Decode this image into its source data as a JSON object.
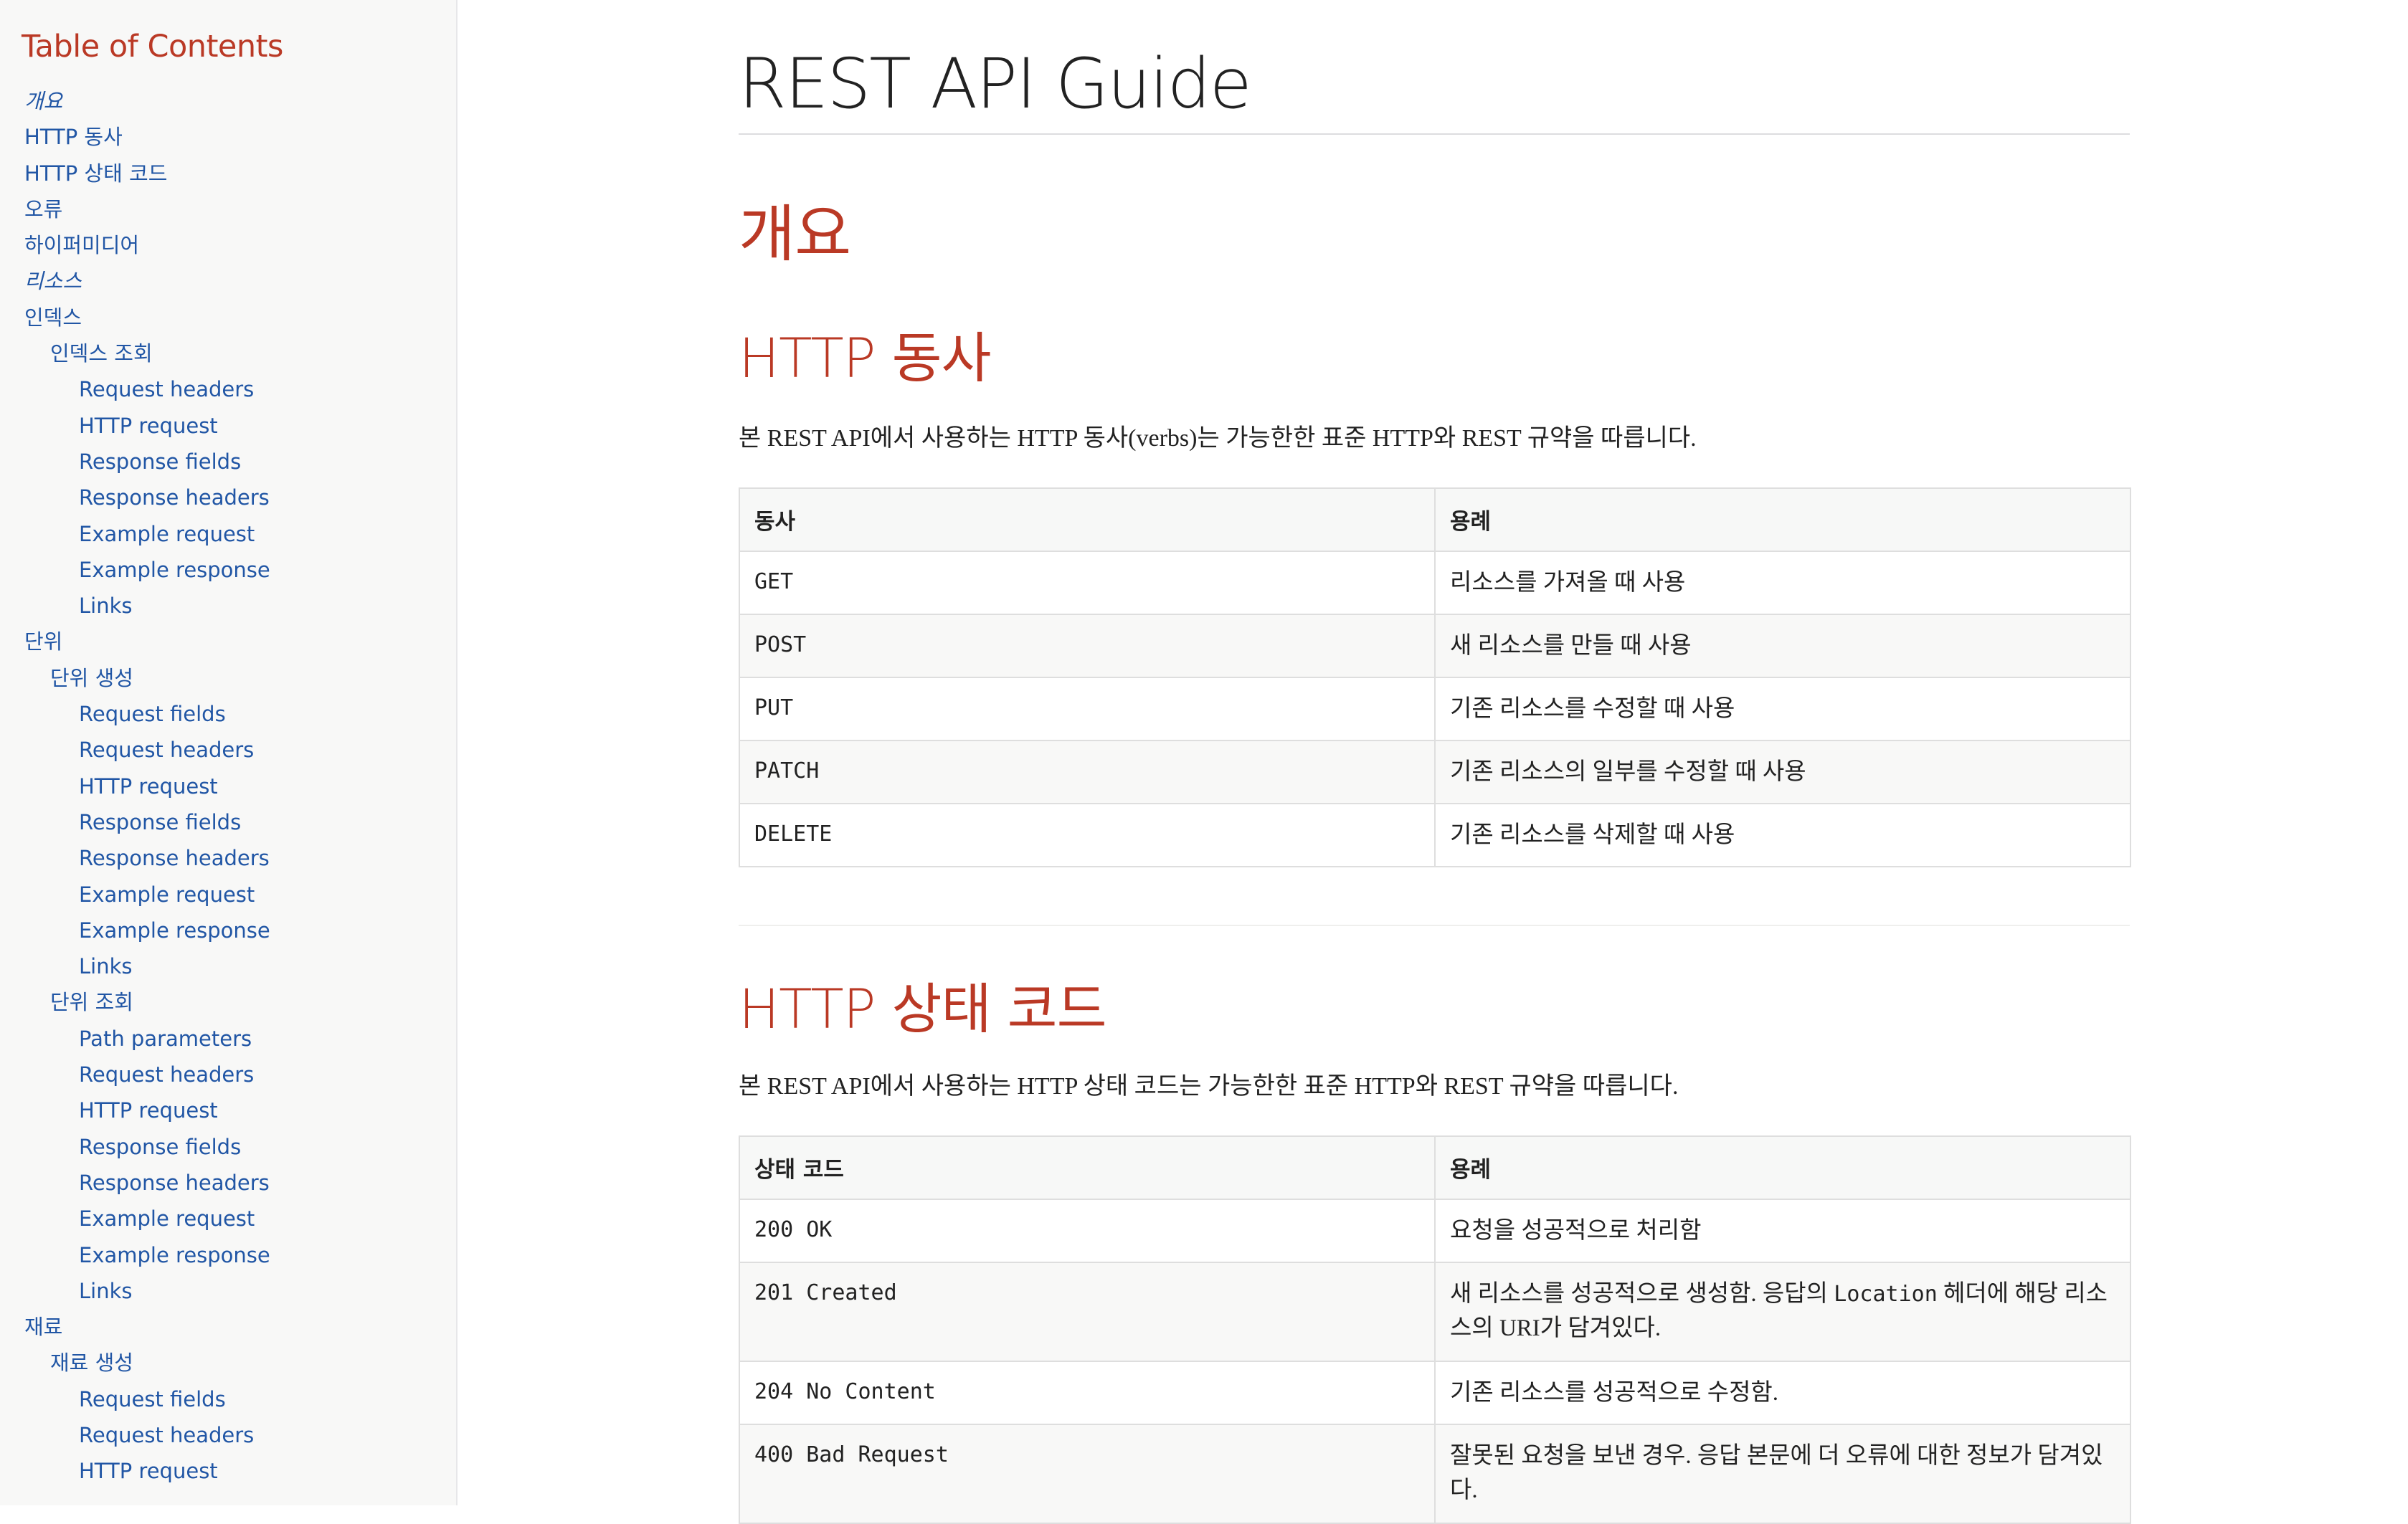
{
  "toc": {
    "title": "Table of Contents",
    "items": [
      {
        "label": "개요",
        "level": 1,
        "italic": true
      },
      {
        "label": "HTTP 동사",
        "level": 1
      },
      {
        "label": "HTTP 상태 코드",
        "level": 1
      },
      {
        "label": "오류",
        "level": 1
      },
      {
        "label": "하이퍼미디어",
        "level": 1
      },
      {
        "label": "리소스",
        "level": 1,
        "italic": true
      },
      {
        "label": "인덱스",
        "level": 1
      },
      {
        "label": "인덱스 조회",
        "level": 2
      },
      {
        "label": "Request headers",
        "level": 3
      },
      {
        "label": "HTTP request",
        "level": 3
      },
      {
        "label": "Response fields",
        "level": 3
      },
      {
        "label": "Response headers",
        "level": 3
      },
      {
        "label": "Example request",
        "level": 3
      },
      {
        "label": "Example response",
        "level": 3
      },
      {
        "label": "Links",
        "level": 3
      },
      {
        "label": "단위",
        "level": 1
      },
      {
        "label": "단위 생성",
        "level": 2
      },
      {
        "label": "Request fields",
        "level": 3
      },
      {
        "label": "Request headers",
        "level": 3
      },
      {
        "label": "HTTP request",
        "level": 3
      },
      {
        "label": "Response fields",
        "level": 3
      },
      {
        "label": "Response headers",
        "level": 3
      },
      {
        "label": "Example request",
        "level": 3
      },
      {
        "label": "Example response",
        "level": 3
      },
      {
        "label": "Links",
        "level": 3
      },
      {
        "label": "단위 조회",
        "level": 2
      },
      {
        "label": "Path parameters",
        "level": 3
      },
      {
        "label": "Request headers",
        "level": 3
      },
      {
        "label": "HTTP request",
        "level": 3
      },
      {
        "label": "Response fields",
        "level": 3
      },
      {
        "label": "Response headers",
        "level": 3
      },
      {
        "label": "Example request",
        "level": 3
      },
      {
        "label": "Example response",
        "level": 3
      },
      {
        "label": "Links",
        "level": 3
      },
      {
        "label": "재료",
        "level": 1
      },
      {
        "label": "재료 생성",
        "level": 2
      },
      {
        "label": "Request fields",
        "level": 3
      },
      {
        "label": "Request headers",
        "level": 3
      },
      {
        "label": "HTTP request",
        "level": 3
      }
    ]
  },
  "doc": {
    "title": "REST API Guide",
    "overview_heading": "개요",
    "verbs": {
      "heading": "HTTP 동사",
      "intro": "본 REST API에서 사용하는 HTTP 동사(verbs)는 가능한한 표준 HTTP와 REST 규약을 따릅니다.",
      "columns": [
        "동사",
        "용례"
      ],
      "rows": [
        [
          "GET",
          "리소스를 가져올 때 사용"
        ],
        [
          "POST",
          "새 리소스를 만들 때 사용"
        ],
        [
          "PUT",
          "기존 리소스를 수정할 때 사용"
        ],
        [
          "PATCH",
          "기존 리소스의 일부를 수정할 때 사용"
        ],
        [
          "DELETE",
          "기존 리소스를 삭제할 때 사용"
        ]
      ]
    },
    "status": {
      "heading": "HTTP 상태 코드",
      "intro": "본 REST API에서 사용하는 HTTP 상태 코드는 가능한한 표준 HTTP와 REST 규약을 따릅니다.",
      "columns": [
        "상태 코드",
        "용례"
      ],
      "rows": [
        {
          "code": "200 OK",
          "desc": "요청을 성공적으로 처리함"
        },
        {
          "code": "201 Created",
          "desc_pre": "새 리소스를 성공적으로 생성함. 응답의 ",
          "desc_code": "Location",
          "desc_post": " 헤더에 해당 리소스의 URI가 담겨있다."
        },
        {
          "code": "204 No Content",
          "desc": "기존 리소스를 성공적으로 수정함."
        },
        {
          "code": "400 Bad Request",
          "desc": "잘못된 요청을 보낸 경우. 응답 본문에 더 오류에 대한 정보가 담겨있다."
        }
      ]
    }
  }
}
